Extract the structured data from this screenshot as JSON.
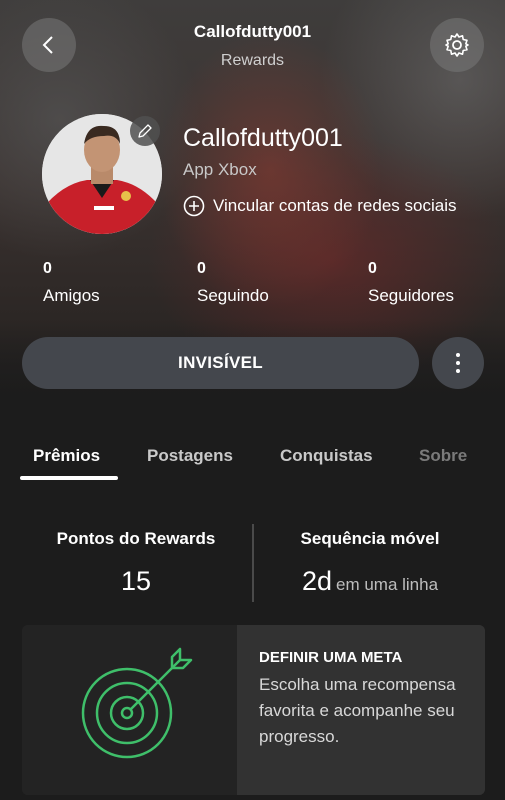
{
  "header": {
    "title": "Callofdutty001",
    "subtitle": "Rewards",
    "back_icon": "chevron-left-icon",
    "settings_icon": "gear-icon"
  },
  "profile": {
    "gamertag": "Callofdutty001",
    "app_label": "App Xbox",
    "link_social_label": "Vincular contas de redes sociais",
    "edit_icon": "pencil-icon"
  },
  "stats": [
    {
      "value": "0",
      "label": "Amigos"
    },
    {
      "value": "0",
      "label": "Seguindo"
    },
    {
      "value": "0",
      "label": "Seguidores"
    }
  ],
  "presence_button": {
    "label": "INVISÍVEL"
  },
  "tabs": [
    {
      "label": "Prêmios",
      "active": true
    },
    {
      "label": "Postagens",
      "active": false
    },
    {
      "label": "Conquistas",
      "active": false
    },
    {
      "label": "Sobre",
      "active": false
    }
  ],
  "rewards": {
    "points_title": "Pontos do Rewards",
    "points_value": "15",
    "streak_title": "Sequência móvel",
    "streak_value": "2d",
    "streak_suffix": "em uma linha"
  },
  "goal_card": {
    "title": "DEFINIR UMA META",
    "description": "Escolha uma recompensa favorita e acompanhe seu progresso.",
    "icon": "target-arrow-icon"
  },
  "colors": {
    "accent_green": "#3fbf6a",
    "background": "#1c1c1c",
    "button": "#44474d"
  }
}
